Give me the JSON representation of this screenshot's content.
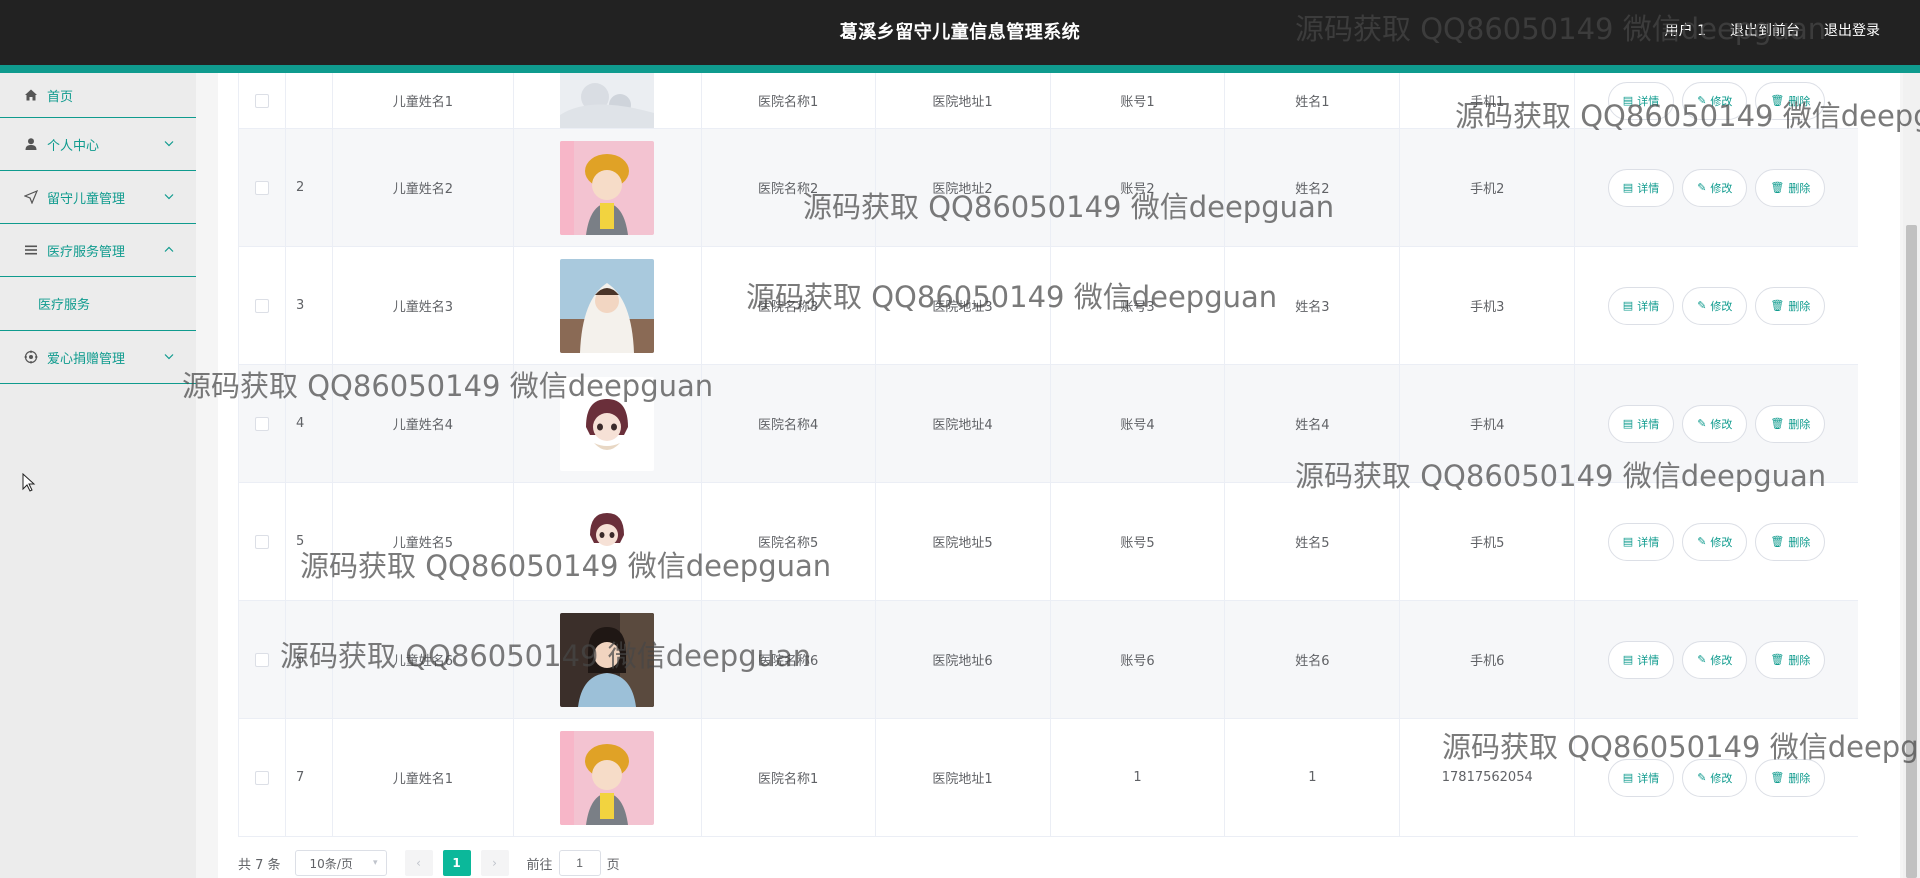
{
  "header": {
    "title": "葛溪乡留守儿童信息管理系统",
    "user_label": "用户 1",
    "front_link": "退出到前台",
    "logout_link": "退出登录"
  },
  "sidebar": {
    "items": [
      {
        "label": "首页",
        "icon": "home-icon"
      },
      {
        "label": "个人中心",
        "icon": "user-icon"
      },
      {
        "label": "留守儿童管理",
        "icon": "send-icon"
      },
      {
        "label": "医疗服务管理",
        "icon": "menu-icon"
      },
      {
        "label": "医疗服务"
      },
      {
        "label": "爱心捐赠管理",
        "icon": "target-icon"
      }
    ]
  },
  "table": {
    "partial_row": {
      "name": "儿童姓名1",
      "hospital_name": "医院名称1",
      "hospital_addr": "医院地址1",
      "account": "账号1",
      "username": "姓名1",
      "phone": "手机1"
    },
    "rows": [
      {
        "idx": "2",
        "name": "儿童姓名2",
        "hospital_name": "医院名称2",
        "hospital_addr": "医院地址2",
        "account": "账号2",
        "username": "姓名2",
        "phone": "手机2"
      },
      {
        "idx": "3",
        "name": "儿童姓名3",
        "hospital_name": "医院名称3",
        "hospital_addr": "医院地址3",
        "account": "账号3",
        "username": "姓名3",
        "phone": "手机3"
      },
      {
        "idx": "4",
        "name": "儿童姓名4",
        "hospital_name": "医院名称4",
        "hospital_addr": "医院地址4",
        "account": "账号4",
        "username": "姓名4",
        "phone": "手机4"
      },
      {
        "idx": "5",
        "name": "儿童姓名5",
        "hospital_name": "医院名称5",
        "hospital_addr": "医院地址5",
        "account": "账号5",
        "username": "姓名5",
        "phone": "手机5"
      },
      {
        "idx": "6",
        "name": "儿童姓名6",
        "hospital_name": "医院名称6",
        "hospital_addr": "医院地址6",
        "account": "账号6",
        "username": "姓名6",
        "phone": "手机6"
      },
      {
        "idx": "7",
        "name": "儿童姓名1",
        "hospital_name": "医院名称1",
        "hospital_addr": "医院地址1",
        "account": "1",
        "username": "1",
        "phone": "17817562054"
      }
    ],
    "actions": {
      "detail": "详情",
      "edit": "修改",
      "delete": "删除"
    }
  },
  "pagination": {
    "total": "共 7 条",
    "page_size": "10条/页",
    "current_page": "1",
    "goto_label": "前往",
    "goto_value": "1",
    "page_suffix": "页"
  },
  "watermark": "源码获取 QQ86050149 微信deepguan",
  "colors": {
    "accent": "#0f9b8e",
    "header_bg": "#222222",
    "page_active": "#0bb89a"
  }
}
